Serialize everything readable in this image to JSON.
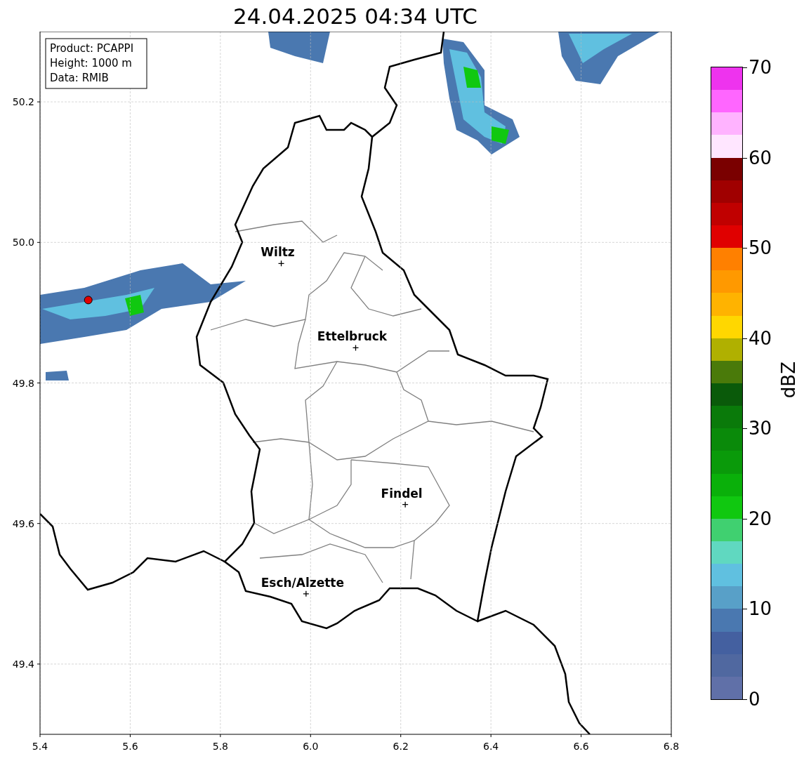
{
  "title": "24.04.2025 04:34 UTC",
  "info_box": [
    "Product: PCAPPI",
    "Height: 1000 m",
    "Data: RMIB"
  ],
  "map": {
    "chart_data": {
      "type": "scatter",
      "xlim": [
        5.4,
        6.8
      ],
      "ylim": [
        49.3,
        50.3
      ],
      "xticks": [
        {
          "value": 5.4,
          "label": "5.4"
        },
        {
          "value": 5.6,
          "label": "5.6"
        },
        {
          "value": 5.8,
          "label": "5.8"
        },
        {
          "value": 6.0,
          "label": "6.0"
        },
        {
          "value": 6.2,
          "label": "6.2"
        },
        {
          "value": 6.4,
          "label": "6.4"
        },
        {
          "value": 6.6,
          "label": "6.6"
        },
        {
          "value": 6.8,
          "label": "6.8"
        }
      ],
      "yticks": [
        {
          "value": 49.4,
          "label": "49.4"
        },
        {
          "value": 49.6,
          "label": "49.6"
        },
        {
          "value": 49.8,
          "label": "49.8"
        },
        {
          "value": 50.0,
          "label": "50.0"
        },
        {
          "value": 50.2,
          "label": "50.2"
        }
      ],
      "grid": true,
      "series": [
        {
          "color": "#000000",
          "x": [
            5.935,
            6.1,
            6.21,
            5.99
          ],
          "values": [
            49.97,
            49.85,
            49.627,
            49.5
          ]
        },
        {
          "color": "#e00000",
          "x": [
            5.507
          ],
          "values": [
            49.918
          ]
        }
      ],
      "annotations": [
        "Wiltz",
        "Ettelbruck",
        "Findel",
        "Esch/Alzette"
      ]
    }
  },
  "colorbar": {
    "label": "dBZ",
    "ticks": [
      "70",
      "60",
      "50",
      "40",
      "30",
      "20",
      "10",
      "0"
    ],
    "bands": [
      {
        "color": "#ee33ee"
      },
      {
        "color": "#ff66ff"
      },
      {
        "color": "#ffb3ff"
      },
      {
        "color": "#ffe6ff"
      },
      {
        "color": "#7a0000"
      },
      {
        "color": "#a00000"
      },
      {
        "color": "#c00000"
      },
      {
        "color": "#e00000"
      },
      {
        "color": "#ff8000"
      },
      {
        "color": "#ff9900"
      },
      {
        "color": "#ffb300"
      },
      {
        "color": "#ffd700"
      },
      {
        "color": "#b0b000"
      },
      {
        "color": "#4a7a0a"
      },
      {
        "color": "#0a5a0a"
      },
      {
        "color": "#0a7a0a"
      },
      {
        "color": "#0a8a0a"
      },
      {
        "color": "#0a9a0a"
      },
      {
        "color": "#0ab00a"
      },
      {
        "color": "#10c810"
      },
      {
        "color": "#40d070"
      },
      {
        "color": "#60d8c0"
      },
      {
        "color": "#60c0e0"
      },
      {
        "color": "#58a0c8"
      },
      {
        "color": "#4a78b0"
      },
      {
        "color": "#4460a0"
      },
      {
        "color": "#5068a0"
      },
      {
        "color": "#6070a8"
      }
    ]
  }
}
